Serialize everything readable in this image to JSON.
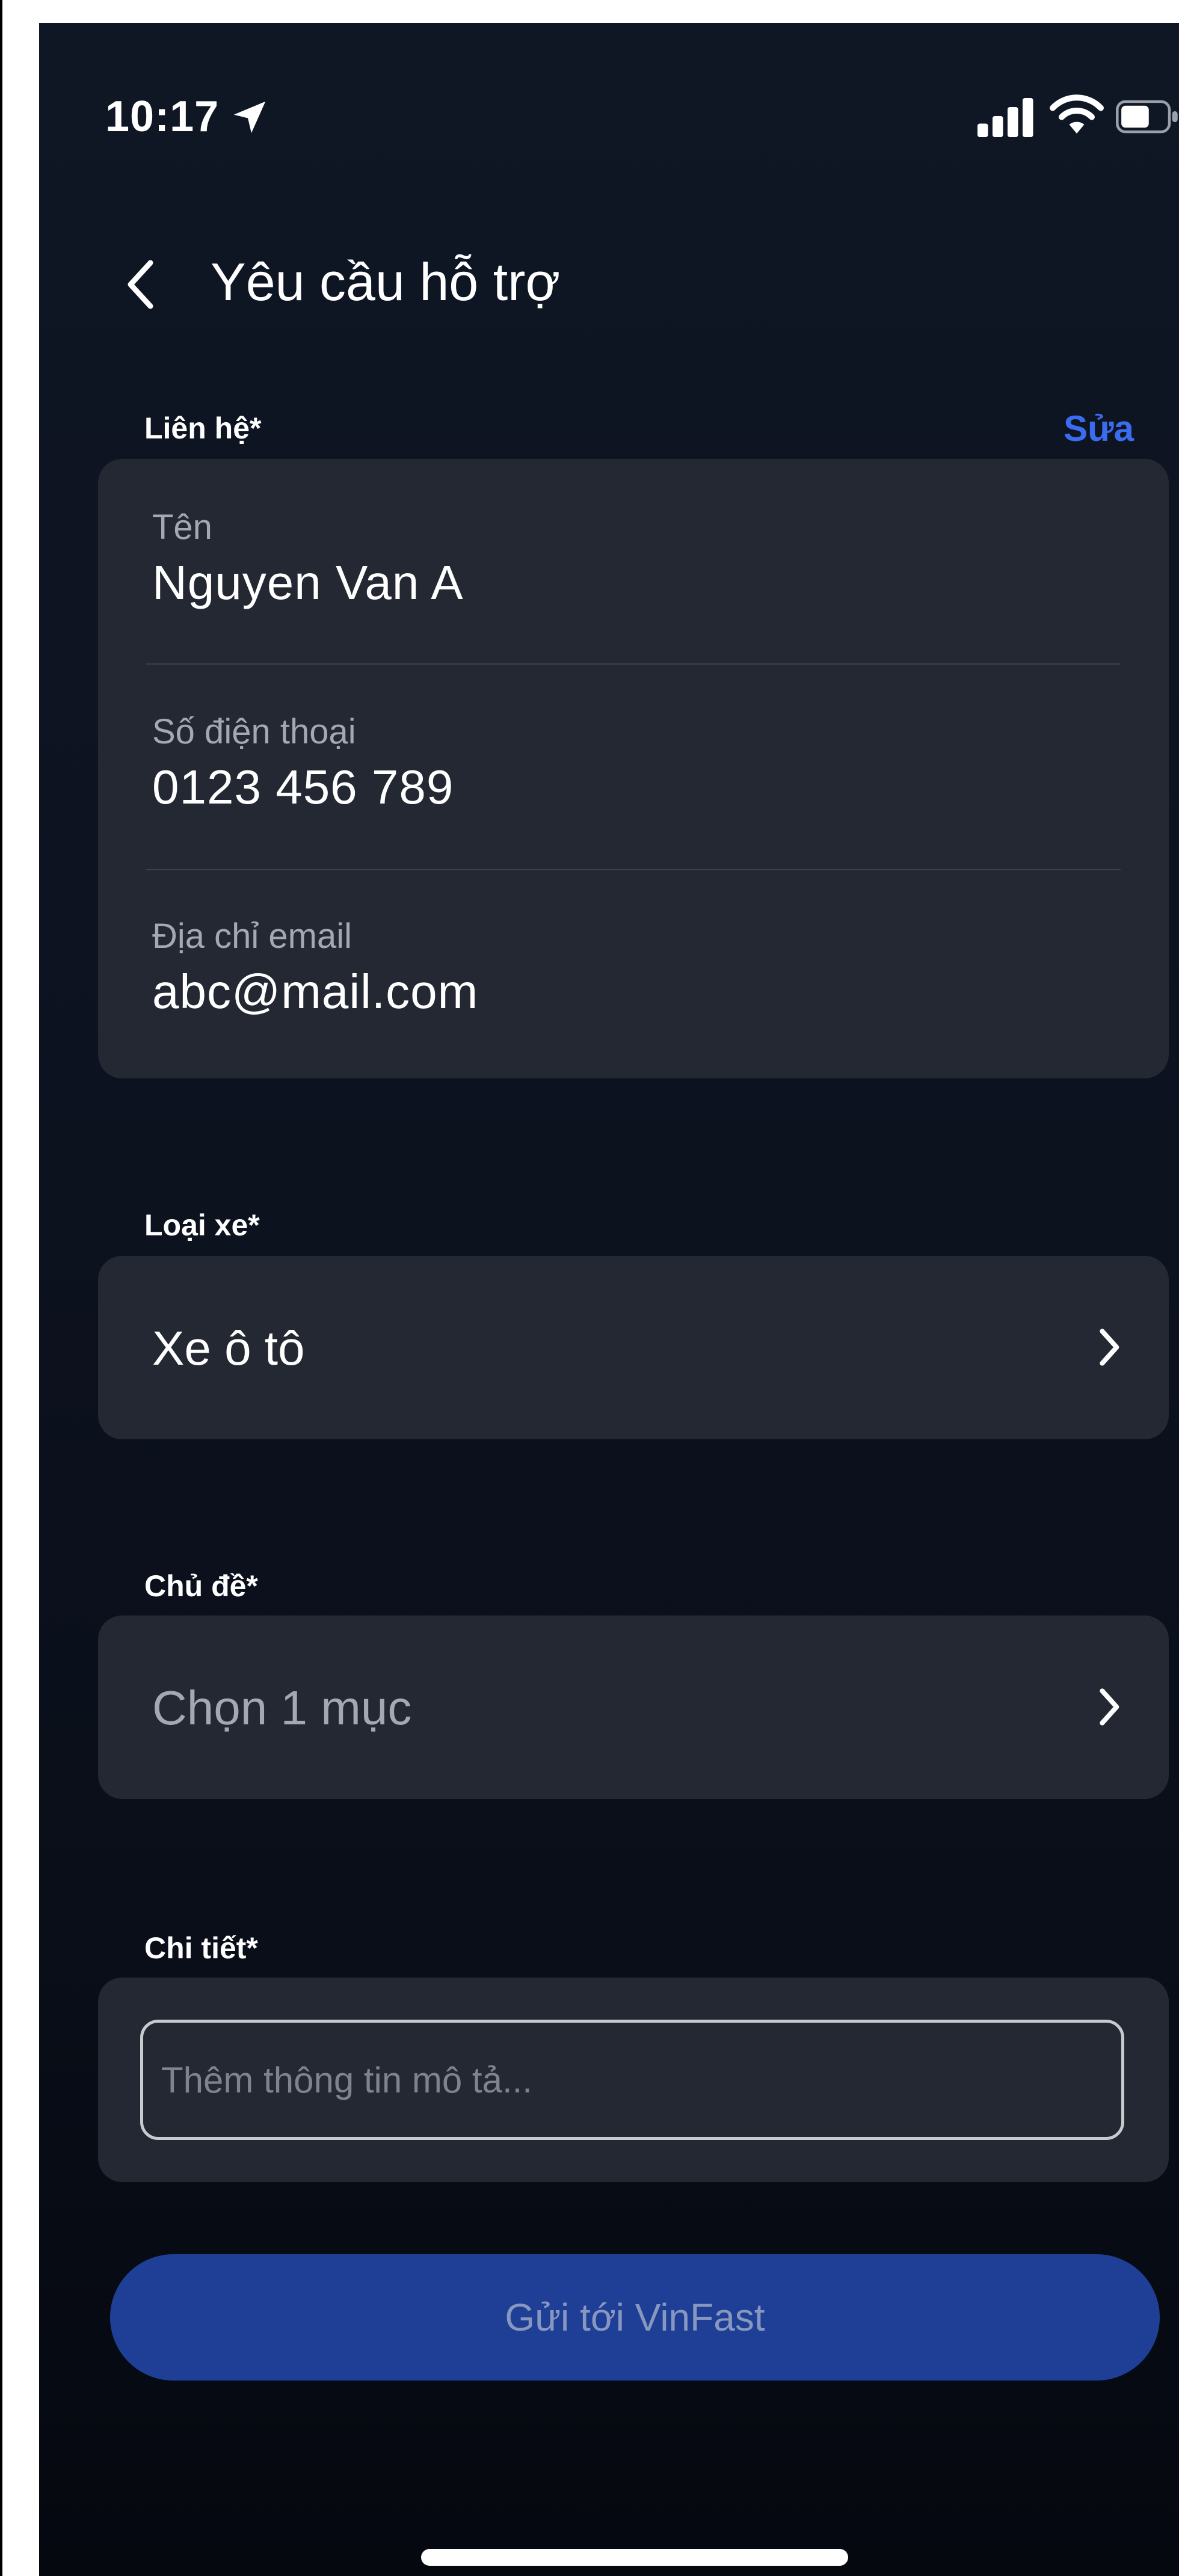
{
  "status_bar": {
    "time": "10:17",
    "icons": [
      "location-arrow-icon",
      "signal-icon",
      "wifi-icon",
      "battery-icon"
    ]
  },
  "header": {
    "back_icon": "chevron-left-icon",
    "title": "Yêu cầu hỗ trợ"
  },
  "contact": {
    "label": "Liên hệ*",
    "edit_label": "Sửa",
    "fields": [
      {
        "label": "Tên",
        "value": "Nguyen Van A"
      },
      {
        "label": "Số điện thoại",
        "value": "0123 456 789"
      },
      {
        "label": "Địa chỉ email",
        "value": "abc@mail.com"
      }
    ]
  },
  "vehicle": {
    "label": "Loại xe*",
    "value": "Xe ô tô"
  },
  "topic": {
    "label": "Chủ đề*",
    "placeholder": "Chọn 1 mục"
  },
  "details": {
    "label": "Chi tiết*",
    "placeholder": "Thêm thông tin mô tả..."
  },
  "submit": {
    "label": "Gửi tới VinFast"
  },
  "colors": {
    "accent": "#3a6cf0",
    "button_bg": "#1e3f95",
    "card_bg": "#232833",
    "screen_bg": "#0d1320"
  }
}
